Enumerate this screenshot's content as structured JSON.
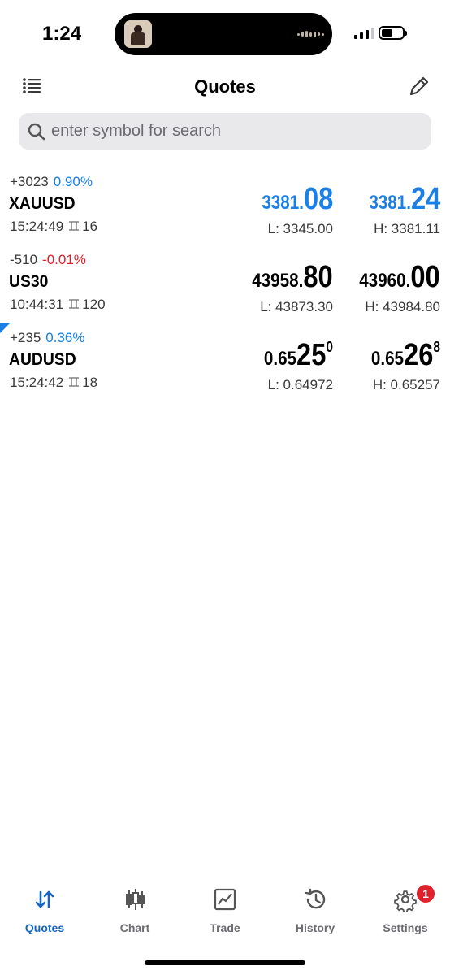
{
  "status_bar": {
    "time": "1:24"
  },
  "header": {
    "title": "Quotes"
  },
  "search": {
    "placeholder": "enter symbol for search"
  },
  "quotes": [
    {
      "change_points": "+3023",
      "change_pct": "0.90%",
      "change_pct_color": "#1a7fe6",
      "symbol": "XAUUSD",
      "time": "15:24:49",
      "spread": "16",
      "bid_prefix": "3381.",
      "bid_big": "08",
      "bid_sup": "",
      "ask_prefix": "3381.",
      "ask_big": "24",
      "ask_sup": "",
      "price_color": "#1a7fe6",
      "low": "L: 3345.00",
      "high": "H: 3381.11"
    },
    {
      "change_points": "-510",
      "change_pct": "-0.01%",
      "change_pct_color": "#e0202a",
      "symbol": "US30",
      "time": "10:44:31",
      "spread": "120",
      "bid_prefix": "43958.",
      "bid_big": "80",
      "bid_sup": "",
      "ask_prefix": "43960.",
      "ask_big": "00",
      "ask_sup": "",
      "price_color": "#000000",
      "low": "L: 43873.30",
      "high": "H: 43984.80"
    },
    {
      "change_points": "+235",
      "change_pct": "0.36%",
      "change_pct_color": "#1a7fe6",
      "symbol": "AUDUSD",
      "time": "15:24:42",
      "spread": "18",
      "bid_prefix": "0.65",
      "bid_big": "25",
      "bid_sup": "0",
      "ask_prefix": "0.65",
      "ask_big": "26",
      "ask_sup": "8",
      "price_color": "#000000",
      "low": "L: 0.64972",
      "high": "H: 0.65257"
    }
  ],
  "tab_bar": {
    "tabs": [
      {
        "label": "Quotes",
        "icon": "quotes-arrows-icon",
        "active": true
      },
      {
        "label": "Chart",
        "icon": "candlestick-chart-icon",
        "active": false
      },
      {
        "label": "Trade",
        "icon": "trade-chart-icon",
        "active": false
      },
      {
        "label": "History",
        "icon": "history-clock-icon",
        "active": false
      },
      {
        "label": "Settings",
        "icon": "gear-icon",
        "active": false,
        "badge": "1"
      }
    ]
  },
  "colors": {
    "accent": "#1a7fe6",
    "negative": "#e0202a",
    "active_tab": "#1565c0"
  }
}
